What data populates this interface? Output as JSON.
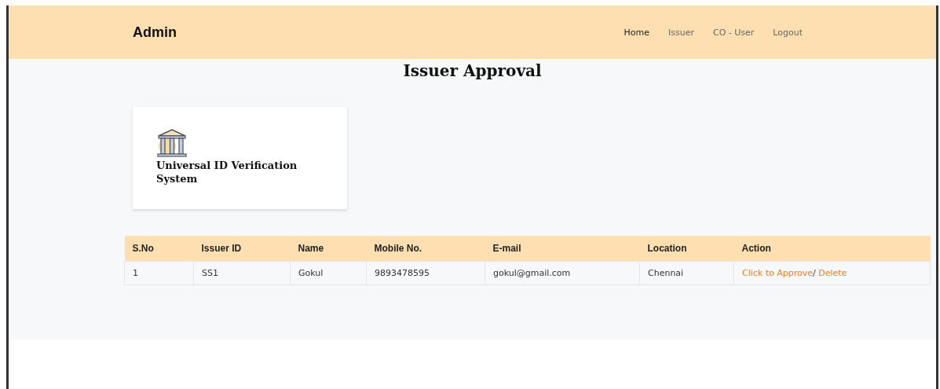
{
  "brand": "Admin",
  "nav": [
    {
      "label": "Home",
      "selected": true
    },
    {
      "label": "Issuer",
      "selected": false
    },
    {
      "label": "CO - User",
      "selected": false
    },
    {
      "label": "Logout",
      "selected": false
    }
  ],
  "page_title": "Issuer Approval",
  "card": {
    "title": "Universal ID Verification System"
  },
  "table": {
    "columns": [
      "S.No",
      "Issuer ID",
      "Name",
      "Mobile No.",
      "E-mail",
      "Location",
      "Action"
    ],
    "rows": [
      {
        "cells": [
          "1",
          "SS1",
          "Gokul",
          "9893478595",
          "gokul@gmail.com",
          "Chennai"
        ],
        "actions": [
          {
            "label": "Click to Approve"
          },
          {
            "label": "Delete"
          }
        ],
        "separator": "/"
      }
    ]
  }
}
